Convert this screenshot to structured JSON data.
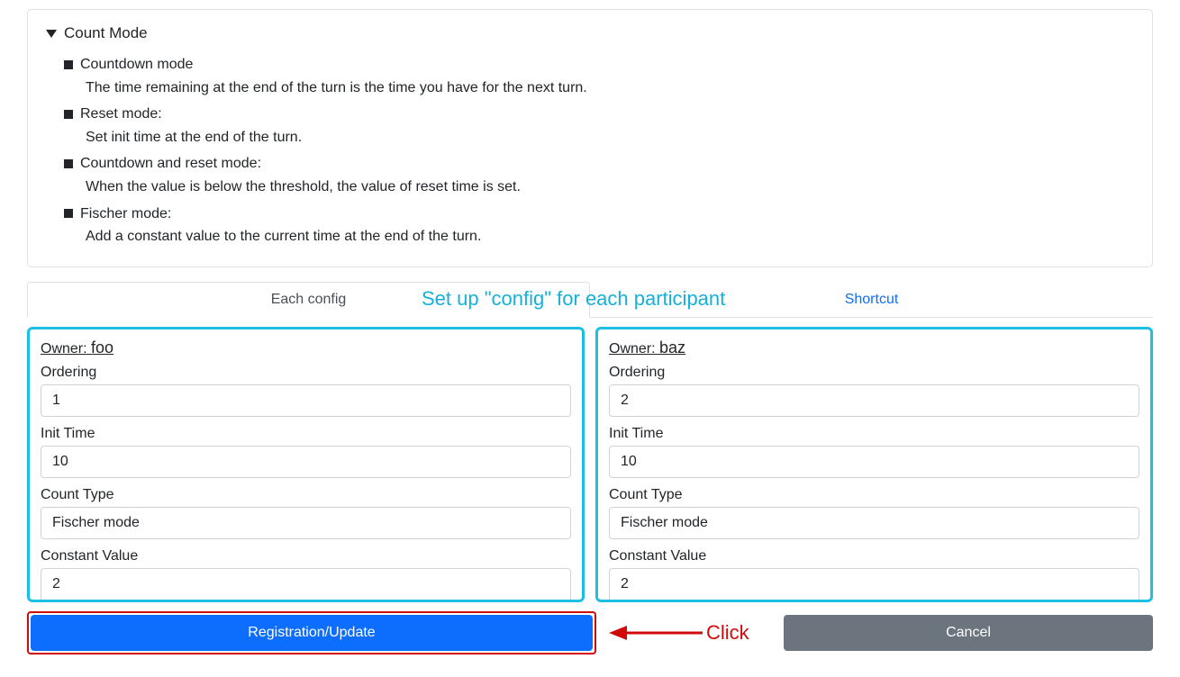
{
  "count_mode": {
    "title": "Count Mode",
    "modes": [
      {
        "name": "Countdown mode",
        "desc": "The time remaining at the end of the turn is the time you have for the next turn."
      },
      {
        "name": "Reset mode:",
        "desc": "Set init time at the end of the turn."
      },
      {
        "name": "Countdown and reset mode:",
        "desc": "When the value is below the threshold, the value of reset time is set."
      },
      {
        "name": "Fischer mode:",
        "desc": "Add a constant value to the current time at the end of the turn."
      }
    ]
  },
  "tabs": {
    "each_config": "Each config",
    "shortcut": "Shortcut"
  },
  "annotations": {
    "setup": "Set up \"config\" for each participant",
    "click": "Click"
  },
  "labels": {
    "owner_prefix": "Owner:",
    "ordering": "Ordering",
    "init_time": "Init Time",
    "count_type": "Count Type",
    "constant_value": "Constant Value"
  },
  "configs": [
    {
      "owner": "foo",
      "ordering": "1",
      "init_time": "10",
      "count_type": "Fischer mode",
      "constant_value": "2"
    },
    {
      "owner": "baz",
      "ordering": "2",
      "init_time": "10",
      "count_type": "Fischer mode",
      "constant_value": "2"
    }
  ],
  "buttons": {
    "register": "Registration/Update",
    "cancel": "Cancel"
  }
}
